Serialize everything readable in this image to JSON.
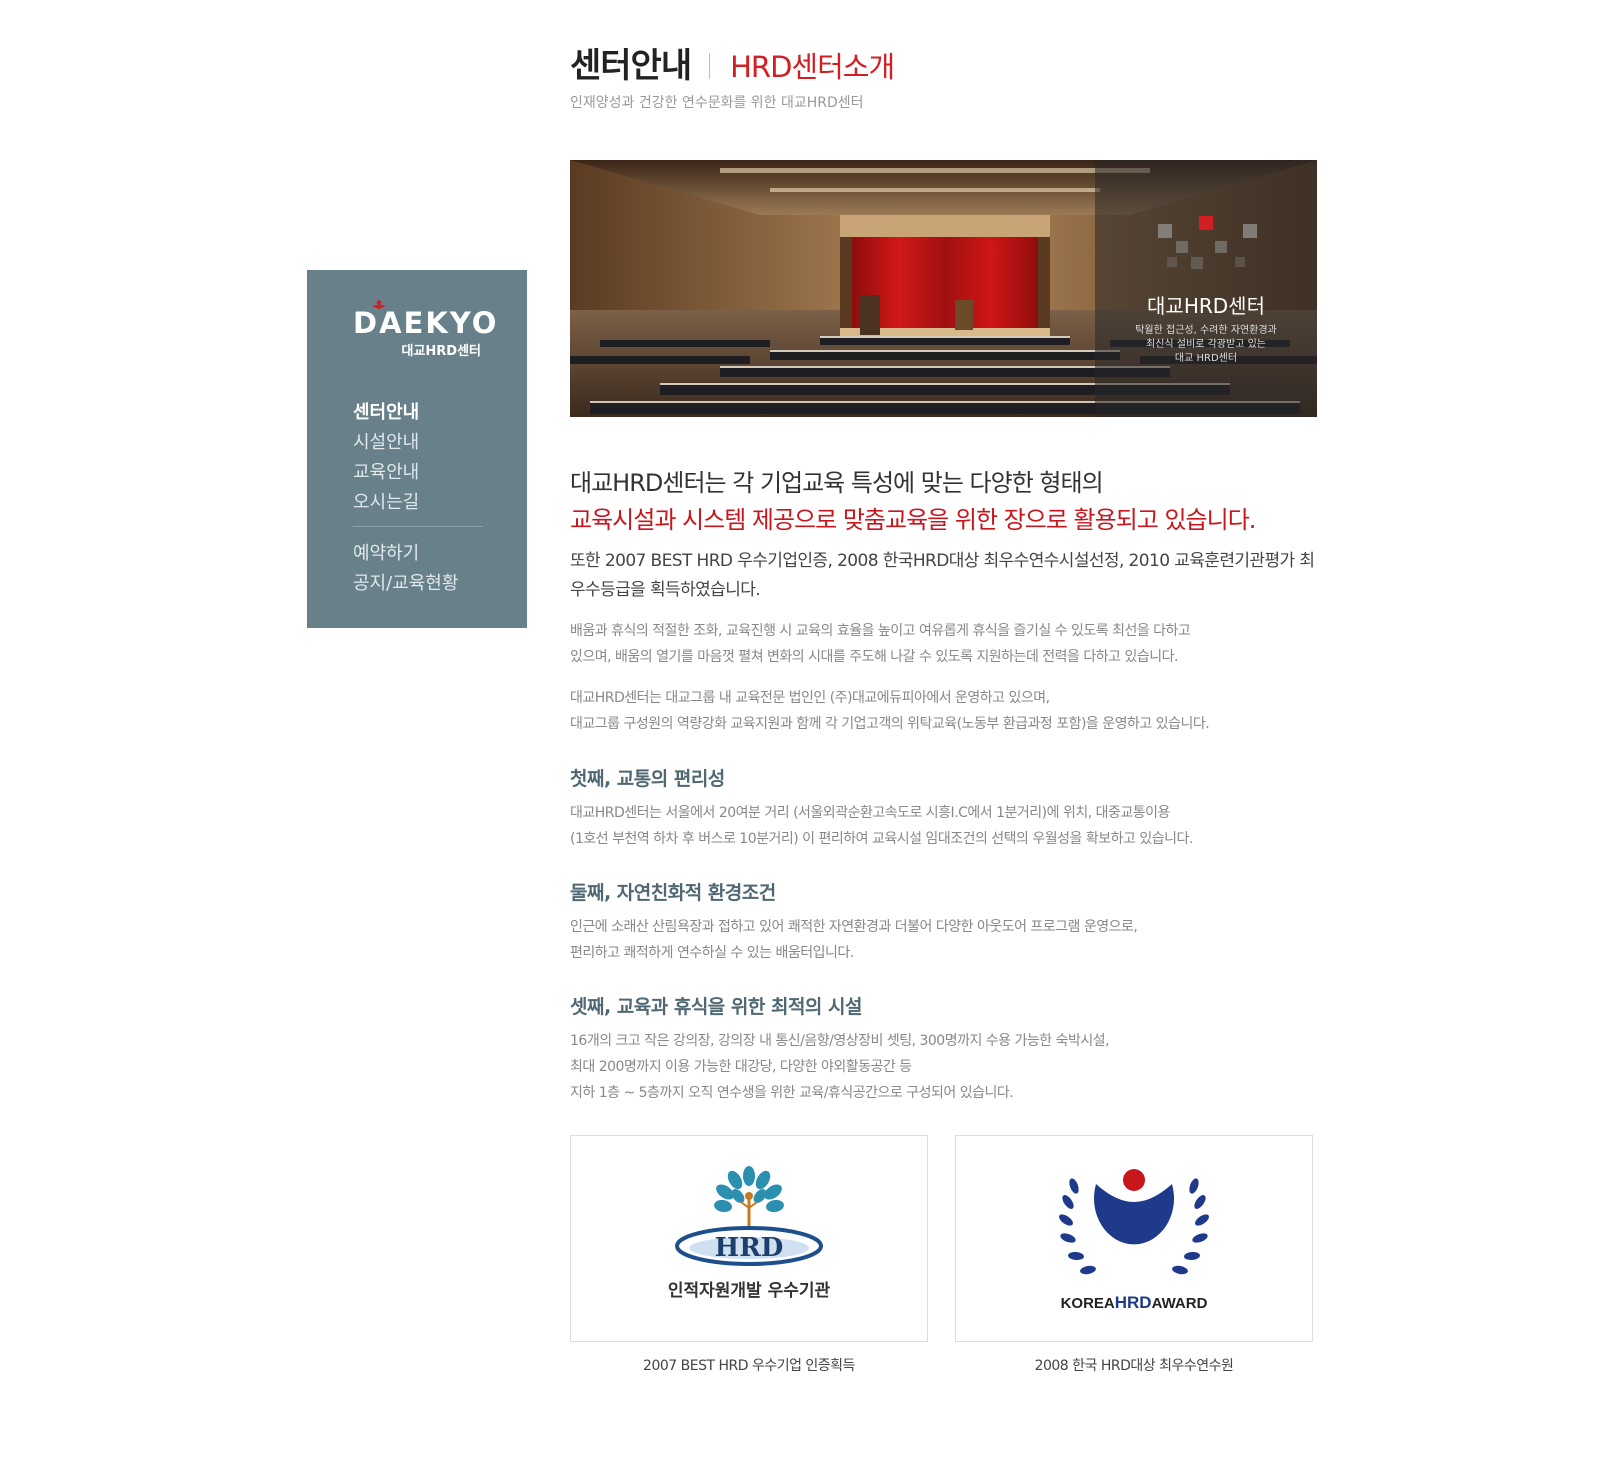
{
  "sidebar": {
    "logo_text": "DAEKYO",
    "logo_sub": "대교HRD센터",
    "nav": [
      {
        "label": "센터안내"
      },
      {
        "label": "시설안내"
      },
      {
        "label": "교육안내"
      },
      {
        "label": "오시는길"
      },
      {
        "label": "예약하기"
      },
      {
        "label": "공지/교육현황"
      }
    ],
    "bg_color": "#67808a"
  },
  "header": {
    "title": "센터안내",
    "title_accent": "HRD센터소개",
    "subtitle": "인재양성과 건강한 연수문화를 위한 대교HRD센터",
    "accent_color": "#d21f24"
  },
  "hero": {
    "caption_title": "대교HRD센터",
    "caption_lines": [
      "탁월한 접근성, 수려한 자연환경과",
      "최신식 설비로 각광받고 있는",
      "대교 HRD센터"
    ]
  },
  "intro": {
    "lead1": "대교HRD센터는 각 기업교육 특성에 맞는 다양한 형태의",
    "lead2": "교육시설과 시스템 제공으로 맞춤교육을 위한 장으로 활용되고 있습니다.",
    "lead3": "또한 2007 BEST HRD 우수기업인증, 2008 한국HRD대상 최우수연수시설선정, 2010 교육훈련기관평가 최우수등급을 획득하였습니다.",
    "para1": [
      "배움과 휴식의 적절한 조화, 교육진행 시 교육의 효율을 높이고 여유롭게 휴식을 즐기실 수 있도록 최선을 다하고",
      "있으며, 배움의 열기를 마음껏 펼쳐 변화의 시대를 주도해 나갈 수 있도록 지원하는데 전력을 다하고 있습니다."
    ],
    "para2": [
      "대교HRD센터는 대교그룹 내 교육전문 법인인 (주)대교에듀피아에서 운영하고 있으며,",
      "대교그룹 구성원의 역량강화 교육지원과 함께 각 기업고객의 위탁교육(노동부 환급과정 포함)을 운영하고 있습니다."
    ]
  },
  "sections": [
    {
      "heading": "첫째, 교통의 편리성",
      "lines": [
        "대교HRD센터는 서울에서 20여분 거리 (서울외곽순환고속도로 시흥I.C에서 1분거리)에 위치, 대중교통이용",
        "(1호선 부천역 하차 후 버스로 10분거리) 이 편리하여 교육시설 임대조건의 선택의 우월성을 확보하고 있습니다."
      ]
    },
    {
      "heading": "둘째, 자연친화적 환경조건",
      "lines": [
        "인근에 소래산 산림욕장과 접하고 있어 쾌적한 자연환경과 더불어 다양한 아웃도어 프로그램 운영으로,",
        "편리하고 쾌적하게 연수하실 수 있는 배움터입니다."
      ]
    },
    {
      "heading": "셋째, 교육과 휴식을 위한 최적의 시설",
      "lines": [
        "16개의 크고 작은 강의장, 강의장 내 통신/음향/영상장비 셋팅, 300명까지 수용 가능한 숙박시설,",
        "최대 200명까지 이용 가능한 대강당, 다양한 야외활동공간 등",
        "지하 1층 ~ 5층까지 오직 연수생을 위한 교육/휴식공간으로 구성되어 있습니다."
      ]
    }
  ],
  "awards": [
    {
      "logo_text": "HRD",
      "logo_sub": "인적자원개발 우수기관",
      "caption": "2007 BEST HRD 우수기업 인증획득"
    },
    {
      "logo_text_a": "KOREA",
      "logo_text_b": "HRD",
      "logo_text_c": "AWARD",
      "caption": "2008 한국 HRD대상 최우수연수원"
    }
  ]
}
